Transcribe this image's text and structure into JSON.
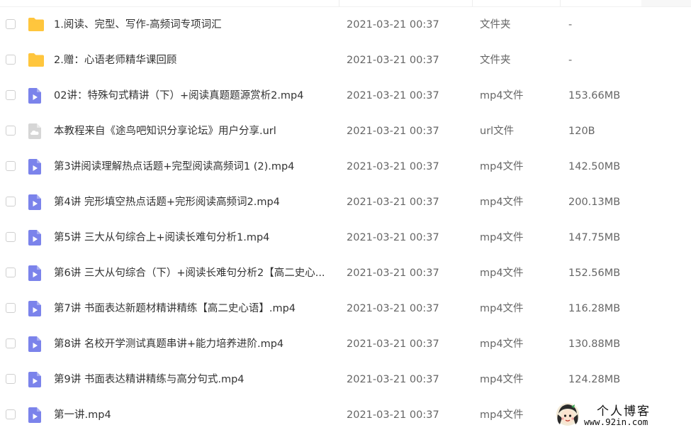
{
  "colors": {
    "folder": "#FFC53D",
    "video": "#7B83EB",
    "url_file": "#D6D6D6"
  },
  "files": [
    {
      "name": "1.阅读、完型、写作-高频词专项词汇",
      "date": "2021-03-21 00:37",
      "type": "文件夹",
      "size": "-",
      "icon": "folder-icon"
    },
    {
      "name": "2.赠：心语老师精华课回顾",
      "date": "2021-03-21 00:37",
      "type": "文件夹",
      "size": "-",
      "icon": "folder-icon"
    },
    {
      "name": "02讲：特殊句式精讲（下）+阅读真题题源赏析2.mp4",
      "date": "2021-03-21 00:37",
      "type": "mp4文件",
      "size": "153.66MB",
      "icon": "video-file-icon"
    },
    {
      "name": "本教程来自《途鸟吧知识分享论坛》用户分享.url",
      "date": "2021-03-21 00:37",
      "type": "url文件",
      "size": "120B",
      "icon": "link-file-icon"
    },
    {
      "name": "第3讲阅读理解热点话题+完型阅读高频词1 (2).mp4",
      "date": "2021-03-21 00:37",
      "type": "mp4文件",
      "size": "142.50MB",
      "icon": "video-file-icon"
    },
    {
      "name": "第4讲 完形填空热点话题+完形阅读高频词2.mp4",
      "date": "2021-03-21 00:37",
      "type": "mp4文件",
      "size": "200.13MB",
      "icon": "video-file-icon"
    },
    {
      "name": "第5讲 三大从句综合上+阅读长难句分析1.mp4",
      "date": "2021-03-21 00:37",
      "type": "mp4文件",
      "size": "147.75MB",
      "icon": "video-file-icon"
    },
    {
      "name": "第6讲 三大从句综合（下）+阅读长难句分析2【高二史心...",
      "date": "2021-03-21 00:37",
      "type": "mp4文件",
      "size": "152.56MB",
      "icon": "video-file-icon"
    },
    {
      "name": "第7讲 书面表达新题材精讲精练【高二史心语】.mp4",
      "date": "2021-03-21 00:37",
      "type": "mp4文件",
      "size": "116.28MB",
      "icon": "video-file-icon"
    },
    {
      "name": "第8讲 名校开学测试真题串讲+能力培养进阶.mp4",
      "date": "2021-03-21 00:37",
      "type": "mp4文件",
      "size": "130.88MB",
      "icon": "video-file-icon"
    },
    {
      "name": "第9讲 书面表达精讲精练与高分句式.mp4",
      "date": "2021-03-21 00:37",
      "type": "mp4文件",
      "size": "124.28MB",
      "icon": "video-file-icon"
    },
    {
      "name": "第一讲.mp4",
      "date": "2021-03-21 00:37",
      "type": "mp4文件",
      "size": "",
      "icon": "video-file-icon"
    }
  ],
  "watermark": {
    "title": "个人博客",
    "url": "www.92in.com"
  }
}
